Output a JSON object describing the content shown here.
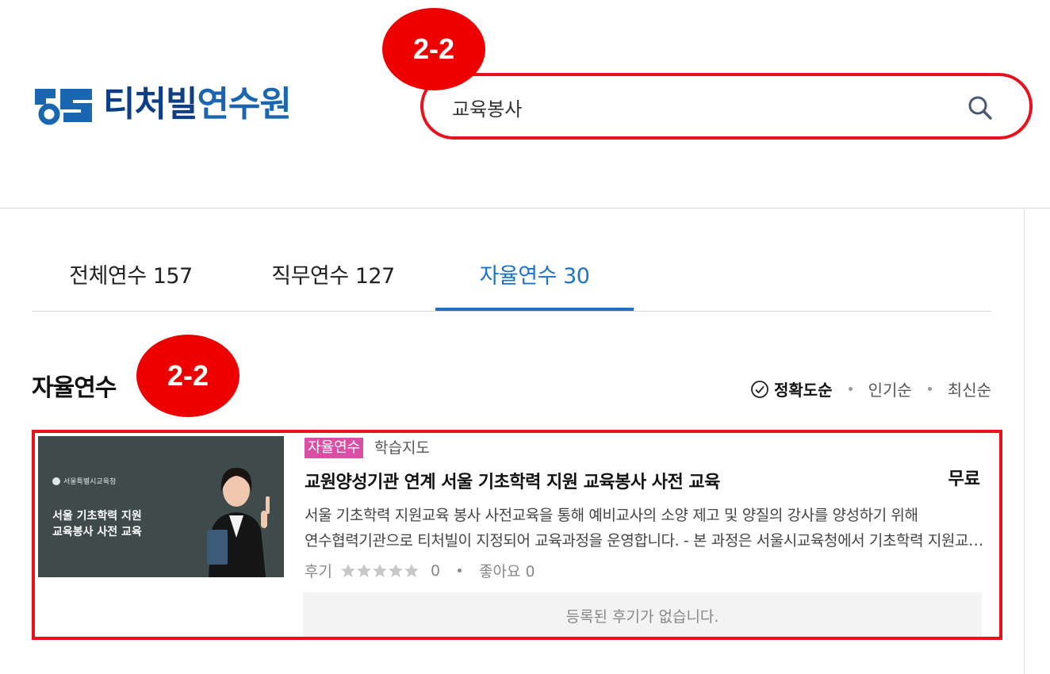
{
  "header": {
    "logo_text_main": "티처빌",
    "logo_text_sub": "연수원",
    "search_value": "교육봉사",
    "search_icon": "search-icon",
    "annotation_top": "2-2"
  },
  "tabs": [
    {
      "label": "전체연수 157",
      "active": false
    },
    {
      "label": "직무연수 127",
      "active": false
    },
    {
      "label": "자율연수 30",
      "active": true
    }
  ],
  "section": {
    "title": "자율연수",
    "annotation": "2-2",
    "sort": {
      "check_icon": "check-circle-icon",
      "options": [
        "정확도순",
        "인기순",
        "최신순"
      ],
      "active": "정확도순"
    }
  },
  "course": {
    "thumbnail": {
      "org": "서울특별시교육청",
      "line1": "서울 기초학력 지원",
      "line2": "교육봉사 사전 교육"
    },
    "tag": "자율연수",
    "category": "학습지도",
    "title": "교원양성기관 연계 서울 기초학력 지원 교육봉사 사전 교육",
    "price": "무료",
    "desc_line1": "서울  기초학력 지원교육 봉사 사전교육을 통해 예비교사의 소양 제고 및 양질의 강사를 양성하기 위해",
    "desc_line2": "연수협력기관으로 티처빌이 지정되어 교육과정을 운영합니다. - 본 과정은 서울시교육청에서 기초학력 지원교육 봉사",
    "review_label": "후기",
    "review_count": "0",
    "like_label": "좋아요 0",
    "rating": 0,
    "no_review": "등록된 후기가 없습니다."
  },
  "colors": {
    "accent": "#1c73c9",
    "annotation_red": "#e8111c",
    "tag_pink": "#d94fa6"
  }
}
